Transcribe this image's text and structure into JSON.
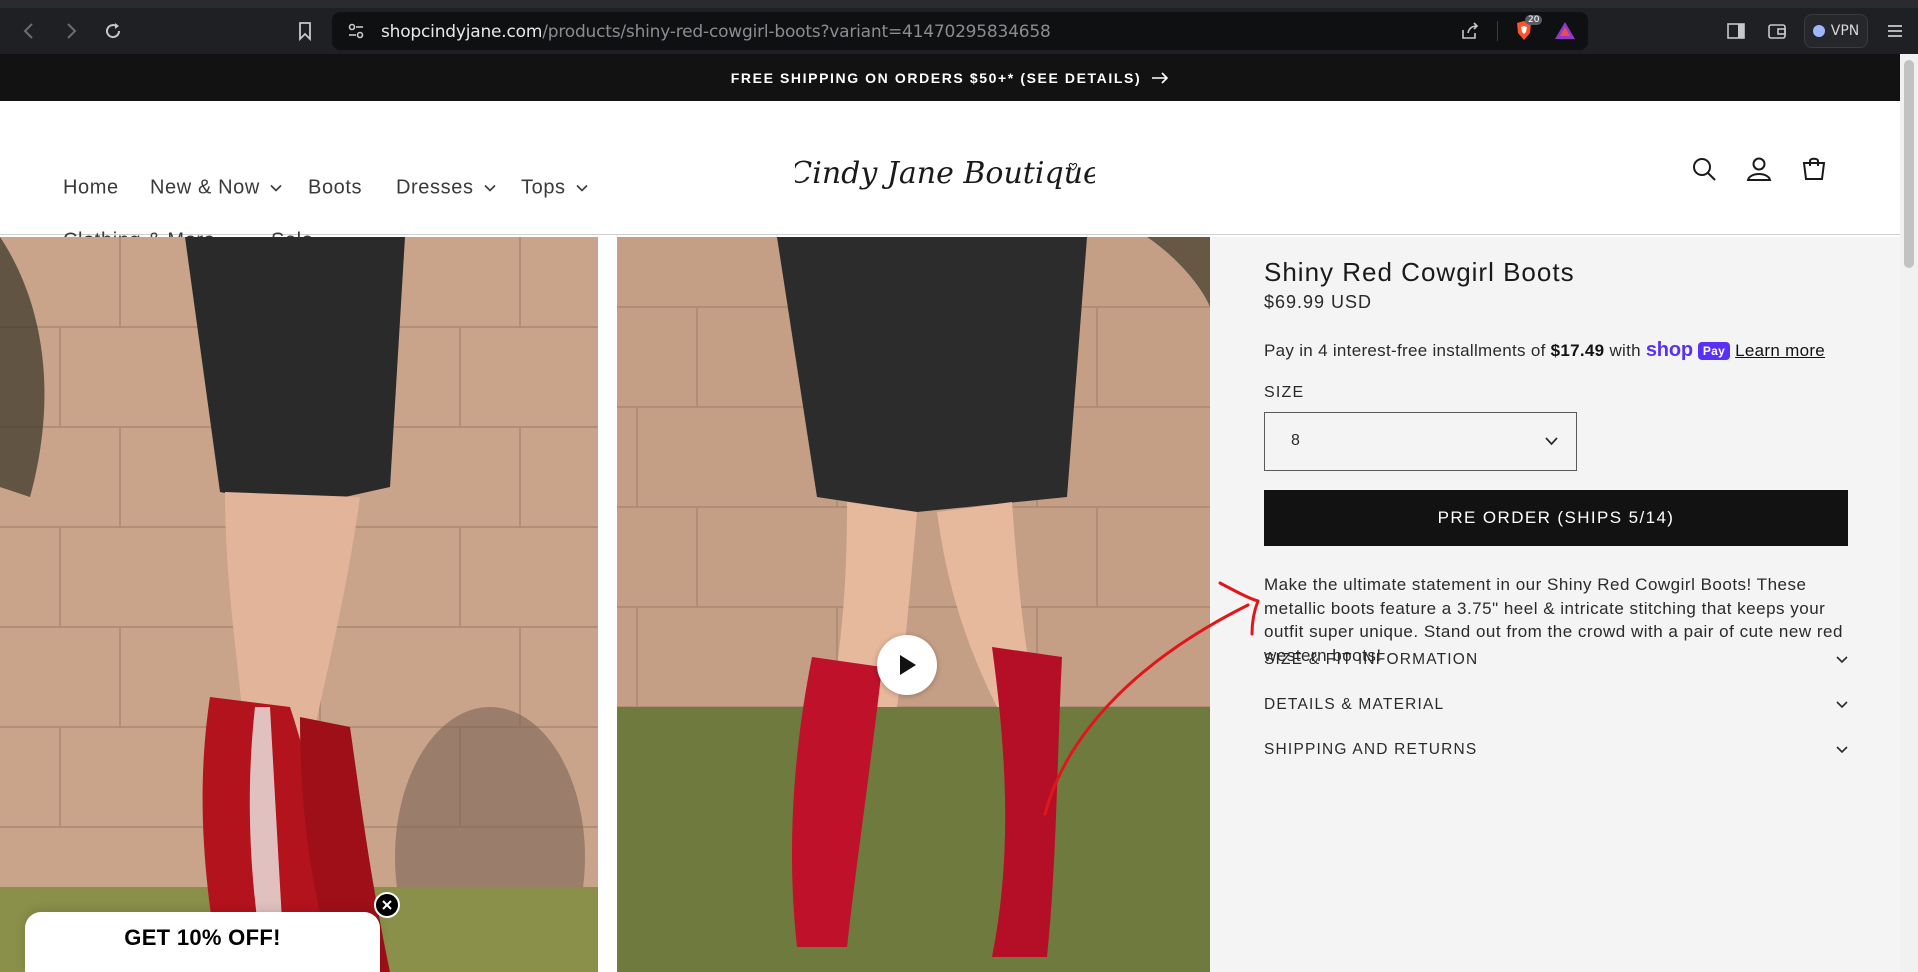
{
  "browser": {
    "url_host": "shopcindyjane.com",
    "url_path": "/products/shiny-red-cowgirl-boots?variant=41470295834658",
    "shield_count": "20",
    "vpn_label": "VPN"
  },
  "announcement": {
    "text": "FREE SHIPPING ON ORDERS $50+* (SEE DETAILS)"
  },
  "nav": {
    "items": [
      {
        "label": "Home"
      },
      {
        "label": "New & Now"
      },
      {
        "label": "Boots"
      },
      {
        "label": "Dresses"
      },
      {
        "label": "Tops"
      },
      {
        "label": "Clothing & More"
      },
      {
        "label": "Sale"
      }
    ]
  },
  "logo": {
    "text": "Cindy Jane Boutique"
  },
  "product": {
    "title": "Shiny Red Cowgirl Boots",
    "price": "$69.99 USD",
    "installments": {
      "prefix": "Pay in 4 interest-free installments of",
      "amount": "$17.49",
      "with": "with",
      "brand": "shop",
      "badge": "Pay",
      "learn_more": "Learn more"
    },
    "size": {
      "label": "SIZE",
      "value": "8"
    },
    "cta_label": "PRE ORDER (SHIPS 5/14)",
    "description": "Make the ultimate statement in our Shiny Red Cowgirl Boots! These metallic boots feature a 3.75\" heel & intricate stitching that keeps your outfit super unique. Stand out from the crowd with a pair of cute new red western boots!",
    "accordions": [
      {
        "title": "SIZE & FIT INFORMATION"
      },
      {
        "title": "DETAILS & MATERIAL"
      },
      {
        "title": "SHIPPING AND RETURNS"
      }
    ]
  },
  "promo": {
    "text": "GET 10% OFF!"
  },
  "colors": {
    "accent": "#121212",
    "shop_pay": "#5a31f4",
    "annotation": "#e0171a"
  }
}
